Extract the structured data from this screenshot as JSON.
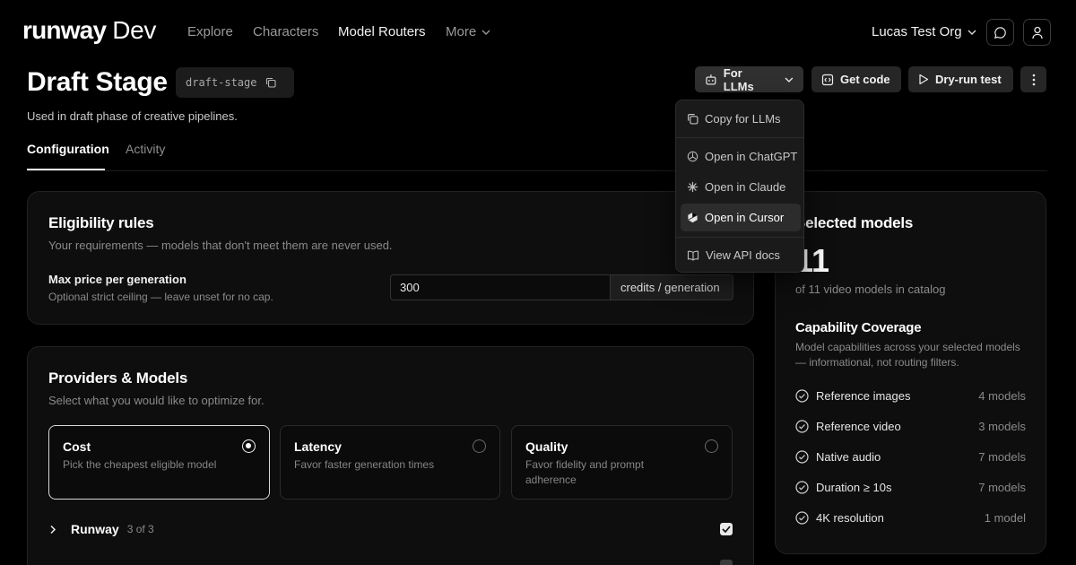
{
  "nav": {
    "logo_main": "runway",
    "logo_suffix": "Dev",
    "links": [
      "Explore",
      "Characters",
      "Model Routers",
      "More"
    ],
    "active_link": "Model Routers",
    "org": "Lucas Test Org"
  },
  "header": {
    "title": "Draft Stage",
    "slug": "draft-stage",
    "description": "Used in draft phase of creative pipelines.",
    "buttons": {
      "for_llms": "For LLMs",
      "get_code": "Get code",
      "dry_run": "Dry-run test"
    }
  },
  "tabs": [
    "Configuration",
    "Activity"
  ],
  "active_tab": "Configuration",
  "eligibility": {
    "title": "Eligibility rules",
    "subtitle": "Your requirements — models that don't meet them are never used.",
    "max_price_label": "Max price per generation",
    "max_price_hint": "Optional strict ceiling — leave unset for no cap.",
    "max_price_value": "300",
    "max_price_unit": "credits / generation"
  },
  "providers": {
    "title": "Providers & Models",
    "subtitle": "Select what you would like to optimize for.",
    "options": [
      {
        "title": "Cost",
        "desc": "Pick the cheapest eligible model",
        "selected": true
      },
      {
        "title": "Latency",
        "desc": "Favor faster generation times",
        "selected": false
      },
      {
        "title": "Quality",
        "desc": "Favor fidelity and prompt adherence",
        "selected": false
      }
    ],
    "rows": [
      {
        "name": "Runway",
        "count": "3 of 3",
        "checked": true
      }
    ]
  },
  "selected": {
    "title": "Selected models",
    "count": "11",
    "catalog_text": "of 11 video models in catalog",
    "coverage_title": "Capability Coverage",
    "coverage_desc": "Model capabilities across your selected models — informational, not routing filters.",
    "capabilities": [
      {
        "label": "Reference images",
        "value": "4 models"
      },
      {
        "label": "Reference video",
        "value": "3 models"
      },
      {
        "label": "Native audio",
        "value": "7 models"
      },
      {
        "label": "Duration ≥ 10s",
        "value": "7 models"
      },
      {
        "label": "4K resolution",
        "value": "1 model"
      }
    ]
  },
  "dropdown": {
    "items": [
      "Copy for LLMs",
      "Open in ChatGPT",
      "Open in Claude",
      "Open in Cursor",
      "View API docs"
    ],
    "hovered": "Open in Cursor"
  }
}
